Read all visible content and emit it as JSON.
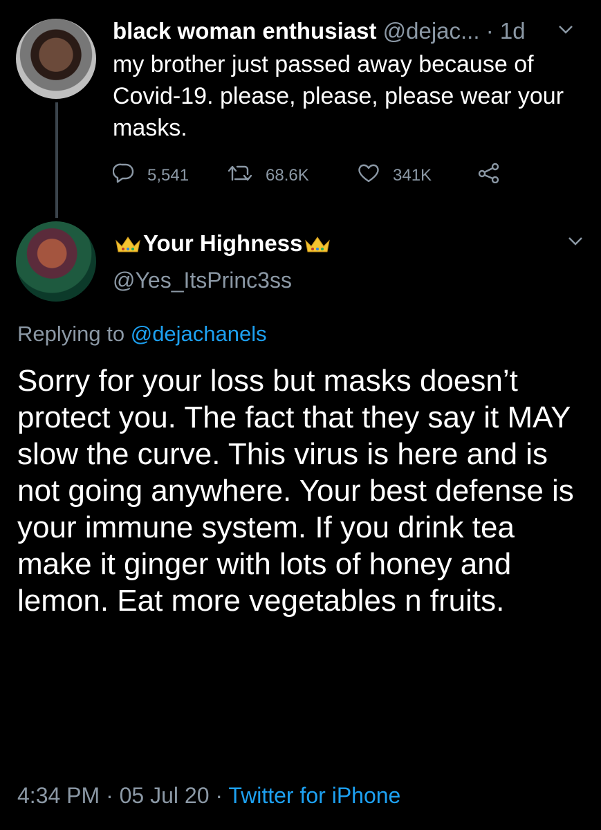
{
  "tweet": {
    "author_name": "black woman enthusiast",
    "author_handle": "@dejac...",
    "separator": "·",
    "time": "1d",
    "text": "my brother just passed away because of Covid-19. please, please, please wear your masks.",
    "replies": "5,541",
    "retweets": "68.6K",
    "likes": "341K",
    "icons": [
      "reply-icon",
      "retweet-icon",
      "like-icon",
      "share-icon",
      "chevron-down-icon"
    ]
  },
  "reply": {
    "author_name": "Your Highness",
    "author_handle": "@Yes_ItsPrinc3ss",
    "replying_prefix": "Replying to",
    "replying_to": "@dejachanels",
    "text": "Sorry for your loss but masks doesn’t protect you. The fact that they say it MAY slow the curve. This virus is here and is not going anywhere. Your best defense is your immune system. If you drink tea make it ginger with lots of honey and lemon. Eat more vegetables n fruits.",
    "time": "4:34 PM",
    "sep1": "·",
    "date": "05 Jul 20",
    "sep2": "·",
    "source": "Twitter for iPhone",
    "name_emoji": "crown-emoji"
  },
  "colors": {
    "background": "#000000",
    "text": "#ffffff",
    "secondary": "#8b98a5",
    "link": "#1da1f2",
    "thread_line": "#3b444c"
  }
}
